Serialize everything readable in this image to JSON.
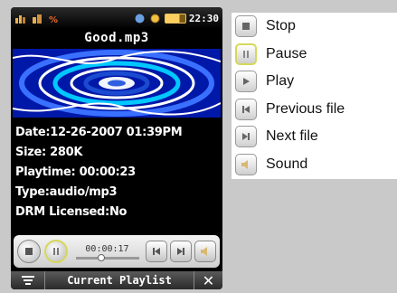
{
  "device": {
    "status": {
      "clock": "22:30"
    },
    "title": "Good.mp3",
    "info": {
      "date": "Date:12-26-2007 01:39PM",
      "size": "Size: 280K",
      "playtime": "Playtime: 00:00:23",
      "type": "Type:audio/mp3",
      "drm": "DRM Licensed:No"
    },
    "controls": {
      "elapsed": "00:00:17",
      "progress_fraction": 0.4
    },
    "bottom": {
      "playlist_label": "Current Playlist",
      "close_glyph": "✕"
    }
  },
  "legend": {
    "items": [
      {
        "label": "Stop",
        "icon": "stop-icon"
      },
      {
        "label": "Pause",
        "icon": "pause-icon"
      },
      {
        "label": "Play",
        "icon": "play-icon"
      },
      {
        "label": "Previous file",
        "icon": "previous-icon"
      },
      {
        "label": "Next file",
        "icon": "next-icon"
      },
      {
        "label": "Sound",
        "icon": "sound-icon"
      }
    ]
  },
  "colors": {
    "art_background": "#0018a8",
    "active_ring": "#d6d85a"
  }
}
